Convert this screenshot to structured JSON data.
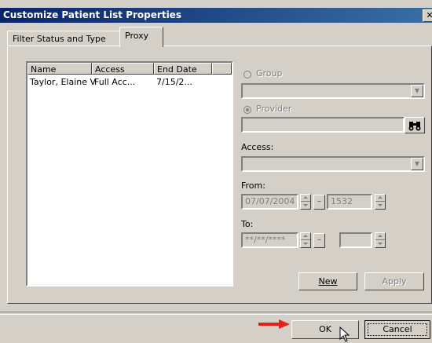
{
  "window": {
    "title": "Customize Patient List Properties",
    "close_glyph": "✕"
  },
  "tabs": [
    {
      "label": "Filter Status and Type"
    },
    {
      "label": "Proxy"
    }
  ],
  "proxy_list": {
    "columns": [
      "Name",
      "Access",
      "End Date",
      ""
    ],
    "rows": [
      [
        "Taylor, Elaine V",
        "Full Acc...",
        "7/15/2..."
      ]
    ]
  },
  "group": {
    "label": "Group",
    "value": ""
  },
  "provider": {
    "label": "Provider",
    "value": "",
    "selected": true
  },
  "access": {
    "label": "Access:",
    "value": ""
  },
  "from": {
    "label": "From:",
    "date": "07/07/2004",
    "time": "1532"
  },
  "to": {
    "label": "To:",
    "date": "**/**/****",
    "time": ""
  },
  "buttons": {
    "new": "New",
    "apply": "Apply",
    "ok": "OK",
    "cancel": "Cancel"
  },
  "colors": {
    "title_start": "#0a246a",
    "title_end": "#3a6ea5",
    "dialog_bg": "#d4d0c8",
    "arrow": "#e8201a"
  }
}
